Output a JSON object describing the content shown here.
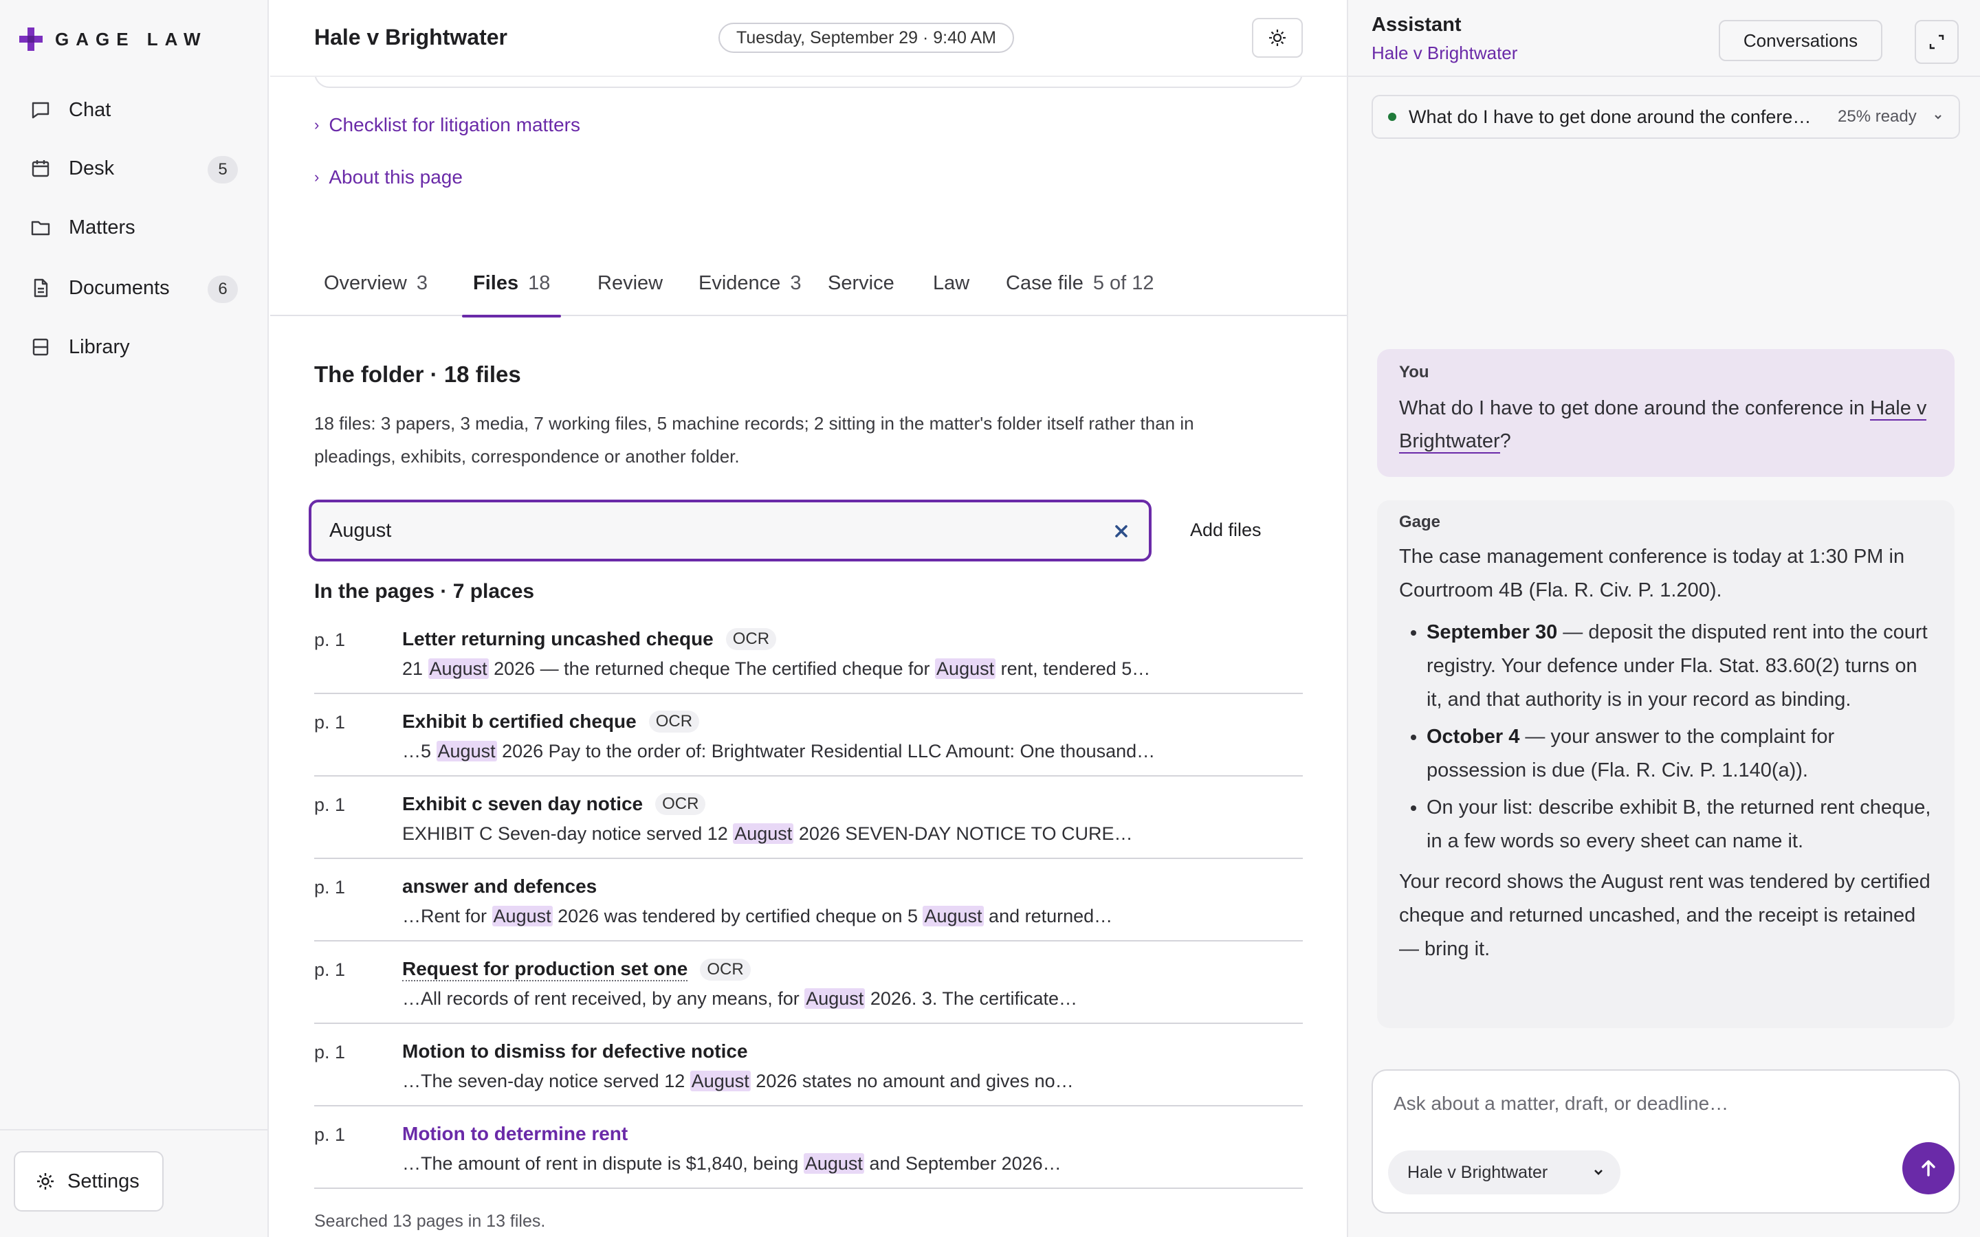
{
  "app": {
    "name": "GAGE LAW",
    "accent_color": "#6a2aa8"
  },
  "sidebar": {
    "items": [
      {
        "label": "Chat",
        "icon": "chat-bubble-icon"
      },
      {
        "label": "Desk",
        "icon": "calendar-icon",
        "badge": "5"
      },
      {
        "label": "Matters",
        "icon": "folder-icon"
      },
      {
        "label": "Documents",
        "icon": "document-icon",
        "badge": "6"
      },
      {
        "label": "Library",
        "icon": "library-icon"
      }
    ],
    "settings_label": "Settings"
  },
  "header": {
    "title": "Hale v Brightwater",
    "date": "Tuesday, September 29 · 9:40 AM",
    "theme_icon": "sun-icon"
  },
  "disclosures": [
    {
      "label": "Checklist for litigation matters"
    },
    {
      "label": "About this page"
    }
  ],
  "tabs": [
    {
      "label": "Overview",
      "count": "3"
    },
    {
      "label": "Files",
      "count": "18",
      "active": true
    },
    {
      "label": "Review",
      "count": ""
    },
    {
      "label": "Evidence",
      "count": "3"
    },
    {
      "label": "Service",
      "count": ""
    },
    {
      "label": "Law",
      "count": ""
    },
    {
      "label": "Case file",
      "count": "5 of 12"
    }
  ],
  "folder": {
    "title": "The folder · 18 files",
    "summary": "18 files: 3 papers, 3 media, 7 working files, 5 machine records; 2 sitting in the matter's folder itself rather than in pleadings, exhibits, correspondence or another folder."
  },
  "search": {
    "value": "August",
    "add_files_label": "Add files"
  },
  "results": {
    "heading": "In the pages · 7 places",
    "term": "August",
    "items": [
      {
        "page": "p. 1",
        "title": "Letter returning uncashed cheque",
        "ocr": "OCR",
        "snippet": "21 August 2026 — the returned cheque The certified cheque for August rent, tendered 5…"
      },
      {
        "page": "p. 1",
        "title": "Exhibit b certified cheque",
        "ocr": "OCR",
        "snippet": "…5 August 2026 Pay to the order of: Brightwater Residential LLC Amount: One thousand…"
      },
      {
        "page": "p. 1",
        "title": "Exhibit c seven day notice",
        "ocr": "OCR",
        "snippet": "EXHIBIT C Seven-day notice served 12 August 2026 SEVEN-DAY NOTICE TO CURE…"
      },
      {
        "page": "p. 1",
        "title": "answer and defences",
        "ocr": "",
        "snippet": "…Rent for August 2026 was tendered by certified cheque on 5 August and returned…"
      },
      {
        "page": "p. 1",
        "title": "Request for production set one",
        "ocr": "OCR",
        "snippet": "…All records of rent received, by any means, for August 2026. 3. The certificate…",
        "style": "dotted"
      },
      {
        "page": "p. 1",
        "title": "Motion to dismiss for defective notice",
        "ocr": "",
        "snippet": "…The seven-day notice served 12 August 2026 states no amount and gives no…"
      },
      {
        "page": "p. 1",
        "title": "Motion to determine rent",
        "ocr": "",
        "snippet": "…The amount of rent in dispute is $1,840, being August and September 2026…",
        "style": "link"
      }
    ],
    "footnote": "Searched 13 pages in 13 files."
  },
  "assistant": {
    "title": "Assistant",
    "subtitle": "Hale v Brightwater",
    "conversations_label": "Conversations",
    "progress": {
      "question": "What do I have to get done around the conference in Hale v Brightwater?",
      "status": "25% ready",
      "status_color": "#1f7a3a"
    },
    "user_message": {
      "label": "You",
      "text_before": "What do I have to get done around the conference in ",
      "matter": "Hale v Brightwater",
      "text_after": "?"
    },
    "reply": {
      "label": "Gage",
      "intro": "The case management conference is today at 1:30 PM in Courtroom 4B (Fla. R. Civ. P. 1.200).",
      "bullets": [
        {
          "bold": "September 30",
          "text": " — deposit the disputed rent into the court registry. Your defence under Fla. Stat. 83.60(2) turns on it, and that authority is in your record as binding."
        },
        {
          "bold": "October 4",
          "text": " — your answer to the complaint for possession is due (Fla. R. Civ. P. 1.140(a))."
        },
        {
          "bold": "",
          "text": "On your list: describe exhibit B, the returned rent cheque, in a few words so every sheet can name it."
        }
      ],
      "closing": "Your record shows the August rent was tendered by certified cheque and returned uncashed, and the receipt is retained — bring it."
    },
    "composer": {
      "placeholder": "Ask about a matter, draft, or deadline…",
      "matter_select": "Hale v Brightwater"
    }
  }
}
